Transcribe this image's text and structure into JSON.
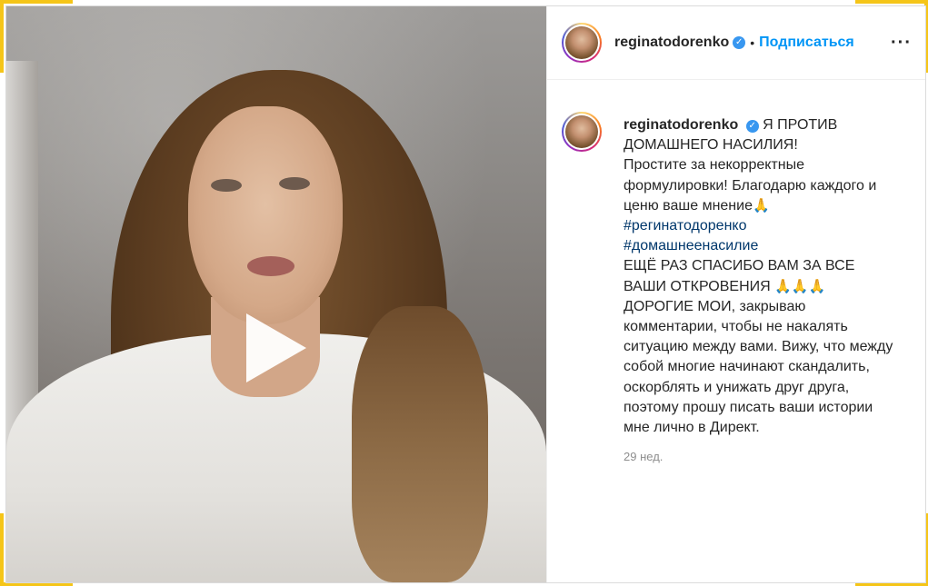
{
  "header": {
    "username": "reginatodorenko",
    "verified_icon": "verified-badge-icon",
    "separator": "•",
    "follow_label": "Подписаться",
    "more_label": "···"
  },
  "caption": {
    "username": "reginatodorenko",
    "line1": "Я ПРОТИВ ДОМАШНЕГО НАСИЛИЯ!",
    "line2": "Простите за некорректные формулировки! Благодарю каждого и ценю ваше мнение",
    "pray_emoji": "🙏",
    "hashtag1": "#регинатодоренко",
    "hashtag2": "#домашнеенасилие",
    "line3": "ЕЩЁ РАЗ СПАСИБО ВАМ ЗА ВСЕ ВАШИ ОТКРОВЕНИЯ",
    "pray_emoji_triple": "🙏🙏🙏",
    "line4": "ДОРОГИЕ МОИ, закрываю комментарии, чтобы не накалять ситуацию между вами. Вижу, что между собой многие начинают скандалить, оскорблять и унижать друг друга, поэтому прошу писать ваши истории мне лично в Директ."
  },
  "timestamp": "29 нед.",
  "colors": {
    "accent": "#0095f6",
    "hashtag": "#00376b",
    "verified": "#3897f0",
    "frame_corner": "#f5c518"
  },
  "media": {
    "play_icon": "play-icon"
  }
}
